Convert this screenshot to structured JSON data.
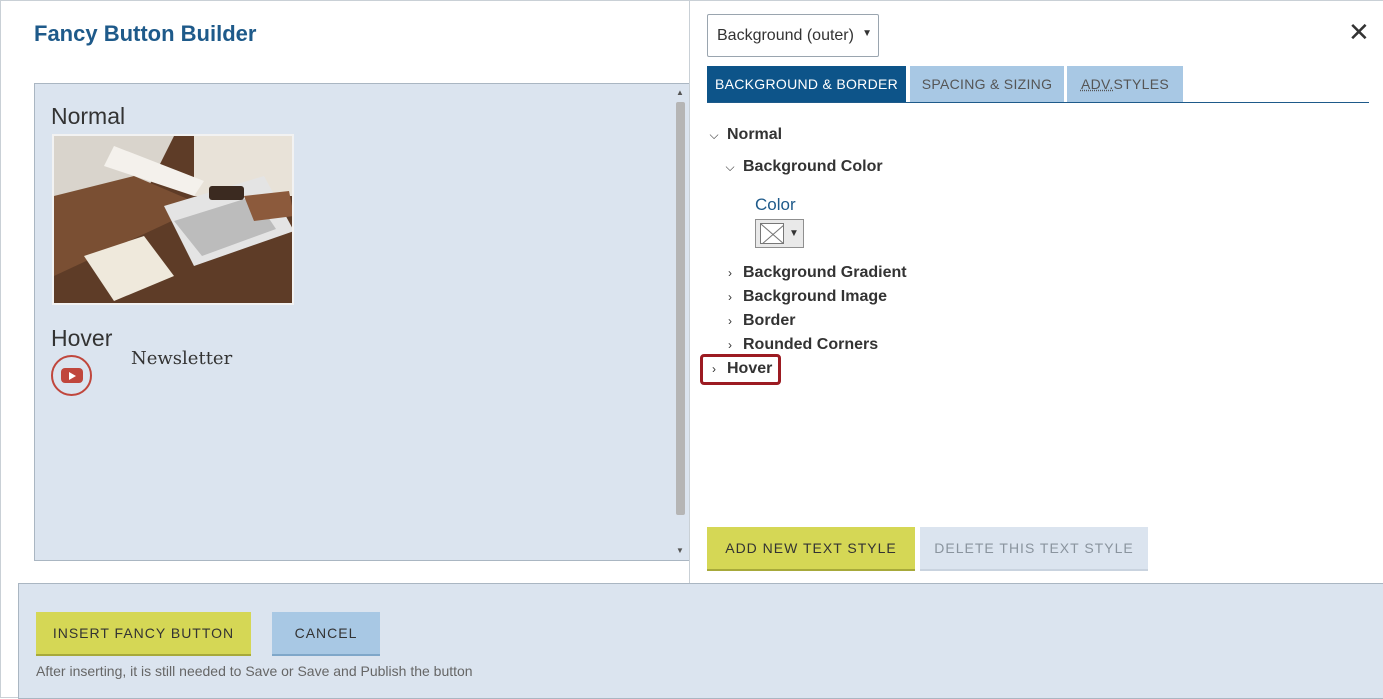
{
  "app": {
    "title": "Fancy Button Builder"
  },
  "preview": {
    "normal_heading": "Normal",
    "hover_heading": "Hover",
    "newsletter_text": "Newsletter",
    "image_icon": "photo-laptop-desk",
    "hover_icon": "youtube-icon"
  },
  "style_select": {
    "value": "Background (outer)"
  },
  "close_label": "✕",
  "tabs": [
    {
      "label": "BACKGROUND & BORDER",
      "active": true
    },
    {
      "label": "SPACING & SIZING",
      "active": false
    },
    {
      "label_abbr": "ADV.",
      "label_rest": " STYLES",
      "active": false
    }
  ],
  "tree": {
    "normal": "Normal",
    "background_color": "Background Color",
    "color_label": "Color",
    "background_gradient": "Background Gradient",
    "background_image": "Background Image",
    "border": "Border",
    "rounded_corners": "Rounded Corners",
    "hover": "Hover"
  },
  "buttons": {
    "add_text_style": "ADD NEW TEXT STYLE",
    "delete_text_style": "DELETE THIS TEXT STYLE",
    "insert": "INSERT FANCY BUTTON",
    "cancel": "CANCEL"
  },
  "footer": {
    "note": "After inserting, it is still needed to Save or Save and Publish the button"
  },
  "colors": {
    "accent_blue": "#0d5489",
    "title_blue": "#1e5a8a",
    "button_yellow": "#d5d755",
    "tab_light_blue": "#a8c8e4",
    "panel_bg": "#dbe4ef",
    "highlight_red": "#9c1b22"
  }
}
